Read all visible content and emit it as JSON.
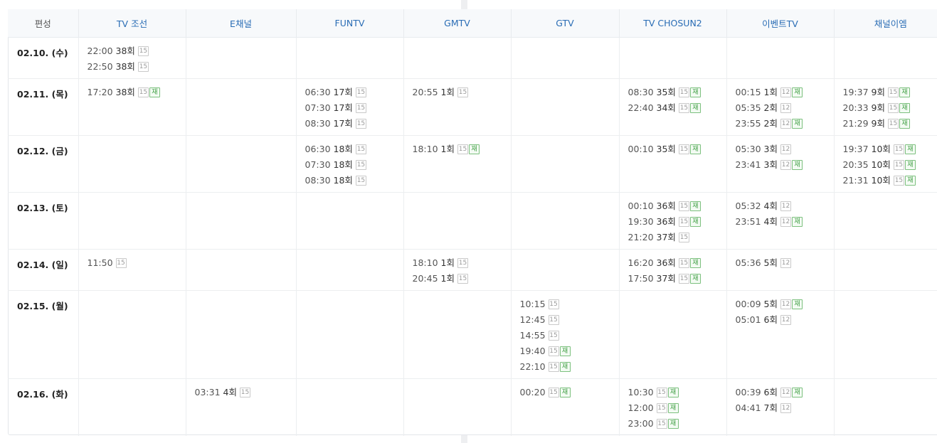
{
  "header": {
    "schedule_label": "편성",
    "channels": [
      "TV 조선",
      "E채널",
      "FUNTV",
      "GMTV",
      "GTV",
      "TV CHOSUN2",
      "이벤트TV",
      "채널이엠"
    ]
  },
  "rows": [
    {
      "date": "02.10. (수)",
      "heightClass": "h1",
      "cells": [
        [
          {
            "time": "22:00",
            "ep": "38회",
            "rating": "15",
            "rerun": ""
          },
          {
            "time": "22:50",
            "ep": "38회",
            "rating": "15",
            "rerun": ""
          }
        ],
        [],
        [],
        [],
        [],
        [],
        [],
        []
      ]
    },
    {
      "date": "02.11. (목)",
      "cells": [
        [
          {
            "time": "17:20",
            "ep": "38회",
            "rating": "15",
            "rerun": "재"
          }
        ],
        [],
        [
          {
            "time": "06:30",
            "ep": "17회",
            "rating": "15",
            "rerun": ""
          },
          {
            "time": "07:30",
            "ep": "17회",
            "rating": "15",
            "rerun": ""
          },
          {
            "time": "08:30",
            "ep": "17회",
            "rating": "15",
            "rerun": ""
          }
        ],
        [
          {
            "time": "20:55",
            "ep": "1회",
            "rating": "15",
            "rerun": ""
          }
        ],
        [],
        [
          {
            "time": "08:30",
            "ep": "35회",
            "rating": "15",
            "rerun": "재"
          },
          {
            "time": "22:40",
            "ep": "34회",
            "rating": "15",
            "rerun": "재"
          }
        ],
        [
          {
            "time": "00:15",
            "ep": "1회",
            "rating": "12",
            "rerun": "재"
          },
          {
            "time": "05:35",
            "ep": "2회",
            "rating": "12",
            "rerun": ""
          },
          {
            "time": "23:55",
            "ep": "2회",
            "rating": "12",
            "rerun": "재"
          }
        ],
        [
          {
            "time": "19:37",
            "ep": "9회",
            "rating": "15",
            "rerun": "재"
          },
          {
            "time": "20:33",
            "ep": "9회",
            "rating": "15",
            "rerun": "재"
          },
          {
            "time": "21:29",
            "ep": "9회",
            "rating": "15",
            "rerun": "재"
          }
        ]
      ]
    },
    {
      "date": "02.12. (금)",
      "cells": [
        [],
        [],
        [
          {
            "time": "06:30",
            "ep": "18회",
            "rating": "15",
            "rerun": ""
          },
          {
            "time": "07:30",
            "ep": "18회",
            "rating": "15",
            "rerun": ""
          },
          {
            "time": "08:30",
            "ep": "18회",
            "rating": "15",
            "rerun": ""
          }
        ],
        [
          {
            "time": "18:10",
            "ep": "1회",
            "rating": "15",
            "rerun": "재"
          }
        ],
        [],
        [
          {
            "time": "00:10",
            "ep": "35회",
            "rating": "15",
            "rerun": "재"
          }
        ],
        [
          {
            "time": "05:30",
            "ep": "3회",
            "rating": "12",
            "rerun": ""
          },
          {
            "time": "23:41",
            "ep": "3회",
            "rating": "12",
            "rerun": "재"
          }
        ],
        [
          {
            "time": "19:37",
            "ep": "10회",
            "rating": "15",
            "rerun": "재"
          },
          {
            "time": "20:35",
            "ep": "10회",
            "rating": "15",
            "rerun": "재"
          },
          {
            "time": "21:31",
            "ep": "10회",
            "rating": "15",
            "rerun": "재"
          }
        ]
      ]
    },
    {
      "date": "02.13. (토)",
      "cells": [
        [],
        [],
        [],
        [],
        [],
        [
          {
            "time": "00:10",
            "ep": "36회",
            "rating": "15",
            "rerun": "재"
          },
          {
            "time": "19:30",
            "ep": "36회",
            "rating": "15",
            "rerun": "재"
          },
          {
            "time": "21:20",
            "ep": "37회",
            "rating": "15",
            "rerun": ""
          }
        ],
        [
          {
            "time": "05:32",
            "ep": "4회",
            "rating": "12",
            "rerun": ""
          },
          {
            "time": "23:51",
            "ep": "4회",
            "rating": "12",
            "rerun": "재"
          }
        ],
        []
      ]
    },
    {
      "date": "02.14. (일)",
      "cells": [
        [
          {
            "time": "11:50",
            "ep": "",
            "rating": "15",
            "rerun": ""
          }
        ],
        [],
        [],
        [
          {
            "time": "18:10",
            "ep": "1회",
            "rating": "15",
            "rerun": ""
          },
          {
            "time": "20:45",
            "ep": "1회",
            "rating": "15",
            "rerun": ""
          }
        ],
        [],
        [
          {
            "time": "16:20",
            "ep": "36회",
            "rating": "15",
            "rerun": "재"
          },
          {
            "time": "17:50",
            "ep": "37회",
            "rating": "15",
            "rerun": "재"
          }
        ],
        [
          {
            "time": "05:36",
            "ep": "5회",
            "rating": "12",
            "rerun": ""
          }
        ],
        []
      ]
    },
    {
      "date": "02.15. (월)",
      "cells": [
        [],
        [],
        [],
        [],
        [
          {
            "time": "10:15",
            "ep": "",
            "rating": "15",
            "rerun": ""
          },
          {
            "time": "12:45",
            "ep": "",
            "rating": "15",
            "rerun": ""
          },
          {
            "time": "14:55",
            "ep": "",
            "rating": "15",
            "rerun": ""
          },
          {
            "time": "19:40",
            "ep": "",
            "rating": "15",
            "rerun": "재"
          },
          {
            "time": "22:10",
            "ep": "",
            "rating": "15",
            "rerun": "재"
          }
        ],
        [],
        [
          {
            "time": "00:09",
            "ep": "5회",
            "rating": "12",
            "rerun": "재"
          },
          {
            "time": "05:01",
            "ep": "6회",
            "rating": "12",
            "rerun": ""
          }
        ],
        []
      ]
    },
    {
      "date": "02.16. (화)",
      "cells": [
        [],
        [
          {
            "time": "03:31",
            "ep": "4회",
            "rating": "15",
            "rerun": ""
          }
        ],
        [],
        [],
        [
          {
            "time": "00:20",
            "ep": "",
            "rating": "15",
            "rerun": "재"
          }
        ],
        [
          {
            "time": "10:30",
            "ep": "",
            "rating": "15",
            "rerun": "재"
          },
          {
            "time": "12:00",
            "ep": "",
            "rating": "15",
            "rerun": "재"
          },
          {
            "time": "23:00",
            "ep": "",
            "rating": "15",
            "rerun": "재"
          }
        ],
        [
          {
            "time": "00:39",
            "ep": "6회",
            "rating": "12",
            "rerun": "재"
          },
          {
            "time": "04:41",
            "ep": "7회",
            "rating": "12",
            "rerun": ""
          }
        ],
        []
      ]
    }
  ]
}
